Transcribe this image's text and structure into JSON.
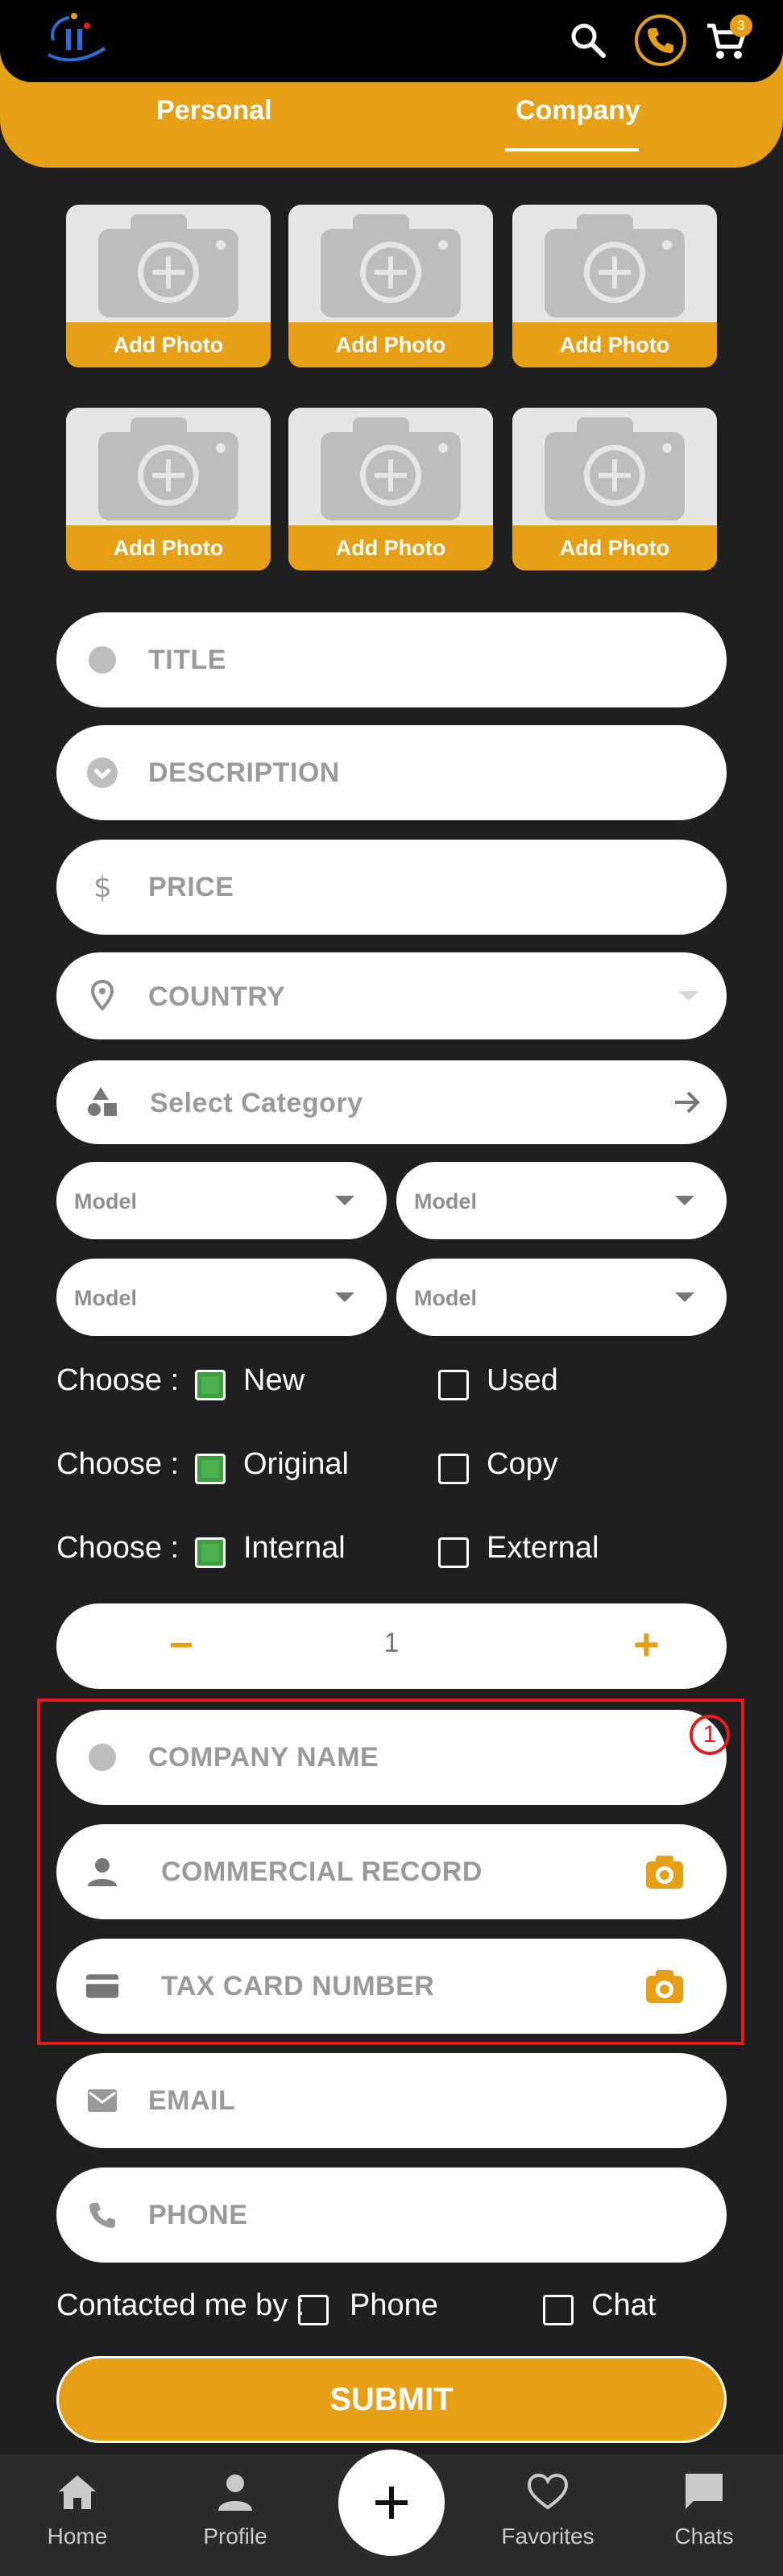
{
  "header": {
    "icons": [
      "logo",
      "search-icon",
      "phone-icon",
      "cart-icon"
    ],
    "cart_count": "3",
    "accent": "#e5a017"
  },
  "tabs": [
    {
      "label": "Personal"
    },
    {
      "label": "Company",
      "active": true
    }
  ],
  "photos": [
    {
      "label": "Add Photo"
    },
    {
      "label": "Add Photo"
    },
    {
      "label": "Add Photo"
    },
    {
      "label": "Add Photo"
    },
    {
      "label": "Add Photo"
    },
    {
      "label": "Add Photo"
    }
  ],
  "fields": {
    "title": {
      "placeholder": "TITLE",
      "icon": "dot-icon"
    },
    "description": {
      "placeholder": "DESCRIPTION",
      "icon": "chevron-circle-icon"
    },
    "price": {
      "placeholder": "PRICE",
      "icon": "dollar-icon"
    },
    "country": {
      "placeholder": "COUNTRY",
      "icon": "location-pin-icon"
    },
    "category": {
      "placeholder": "Select Category",
      "icon": "shapes-icon"
    }
  },
  "models": [
    {
      "placeholder": "Model"
    },
    {
      "placeholder": "Model"
    },
    {
      "placeholder": "Model"
    },
    {
      "placeholder": "Model"
    }
  ],
  "choices": [
    {
      "prefix": "Choose :",
      "option_a": "New",
      "option_a_checked": true,
      "option_b": "Used",
      "option_b_checked": false
    },
    {
      "prefix": "Choose :",
      "option_a": "Original",
      "option_a_checked": true,
      "option_b": "Copy",
      "option_b_checked": false
    },
    {
      "prefix": "Choose :",
      "option_a": "Internal",
      "option_a_checked": true,
      "option_b": "External",
      "option_b_checked": false
    }
  ],
  "stepper": {
    "minus": "−",
    "value": "1",
    "plus": "+"
  },
  "company_fields": {
    "company_name": {
      "placeholder": "COMPANY NAME",
      "icon": "dot-icon"
    },
    "commercial_record": {
      "placeholder": "COMMERCIAL RECORD",
      "icon": "person-icon"
    },
    "tax_card": {
      "placeholder": "TAX CARD NUMBER",
      "icon": "credit-card-icon"
    }
  },
  "annotation": {
    "number": "1",
    "color": "#e31b1b"
  },
  "contact_fields": {
    "email": {
      "placeholder": "EMAIL",
      "icon": "mail-icon"
    },
    "phone": {
      "placeholder": "PHONE",
      "icon": "phone-icon"
    }
  },
  "contact_by": {
    "label": "Contacted me by :",
    "option_a": "Phone",
    "option_b": "Chat"
  },
  "submit_label": "SUBMIT",
  "bottom_nav": [
    {
      "label": "Home",
      "icon": "home-icon"
    },
    {
      "label": "Profile",
      "icon": "person-icon"
    },
    {
      "label": "",
      "icon": "plus-icon"
    },
    {
      "label": "Favorites",
      "icon": "heart-icon"
    },
    {
      "label": "Chats",
      "icon": "chat-icon"
    }
  ]
}
